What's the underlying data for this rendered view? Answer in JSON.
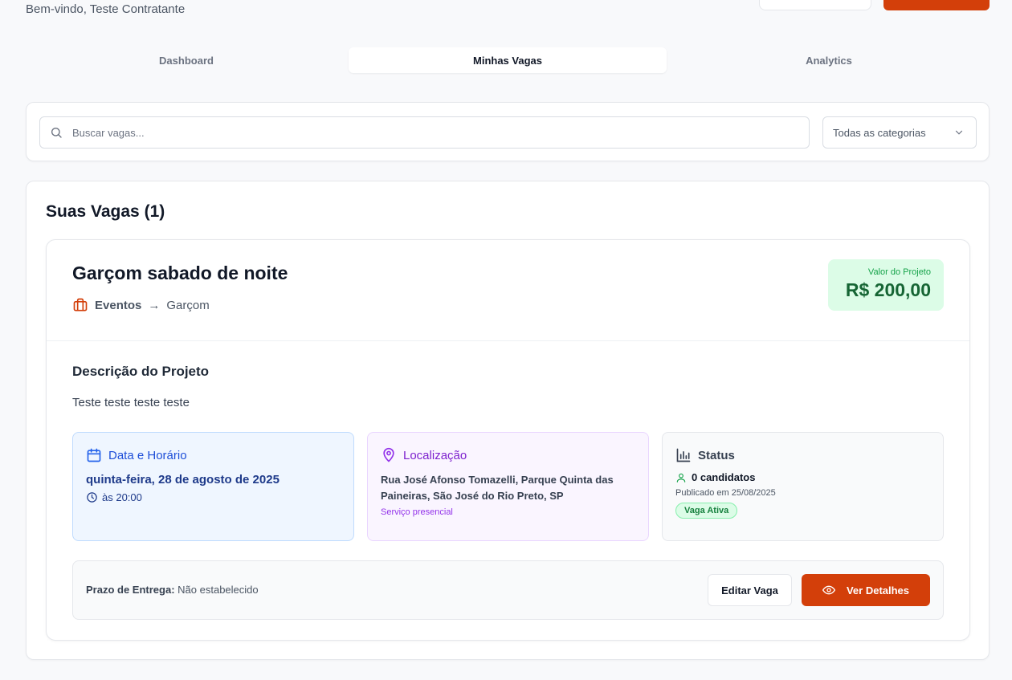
{
  "header": {
    "welcome": "Bem-vindo, Teste Contratante"
  },
  "tabs": [
    {
      "label": "Dashboard",
      "active": false
    },
    {
      "label": "Minhas Vagas",
      "active": true
    },
    {
      "label": "Analytics",
      "active": false
    }
  ],
  "filters": {
    "search_placeholder": "Buscar vagas...",
    "search_value": "",
    "category_selected": "Todas as categorias"
  },
  "jobs_section": {
    "title": "Suas Vagas (1)"
  },
  "job": {
    "title": "Garçom sabado de noite",
    "category": "Eventos",
    "arrow": "→",
    "subcategory": "Garçom",
    "price_label": "Valor do Projeto",
    "price_value": "R$ 200,00",
    "description_title": "Descrição do Projeto",
    "description": "Teste teste teste teste",
    "date_box": {
      "title": "Data e Horário",
      "date": "quinta-feira, 28 de agosto de 2025",
      "time": "às 20:00"
    },
    "location_box": {
      "title": "Localização",
      "address": "Rua José Afonso Tomazelli, Parque Quinta das Paineiras, São José do Rio Preto, SP",
      "note": "Serviço presencial"
    },
    "status_box": {
      "title": "Status",
      "candidates": "0 candidatos",
      "published": "Publicado em 25/08/2025",
      "badge": "Vaga Ativa"
    },
    "deadline_label": "Prazo de Entrega:",
    "deadline_value": "Não estabelecido",
    "edit_button": "Editar Vaga",
    "details_button": "Ver Detalhes"
  },
  "colors": {
    "accent": "#d33f0a",
    "price_bg": "#dcfce7",
    "date_bg": "#eff6ff",
    "location_bg": "#faf5ff"
  }
}
